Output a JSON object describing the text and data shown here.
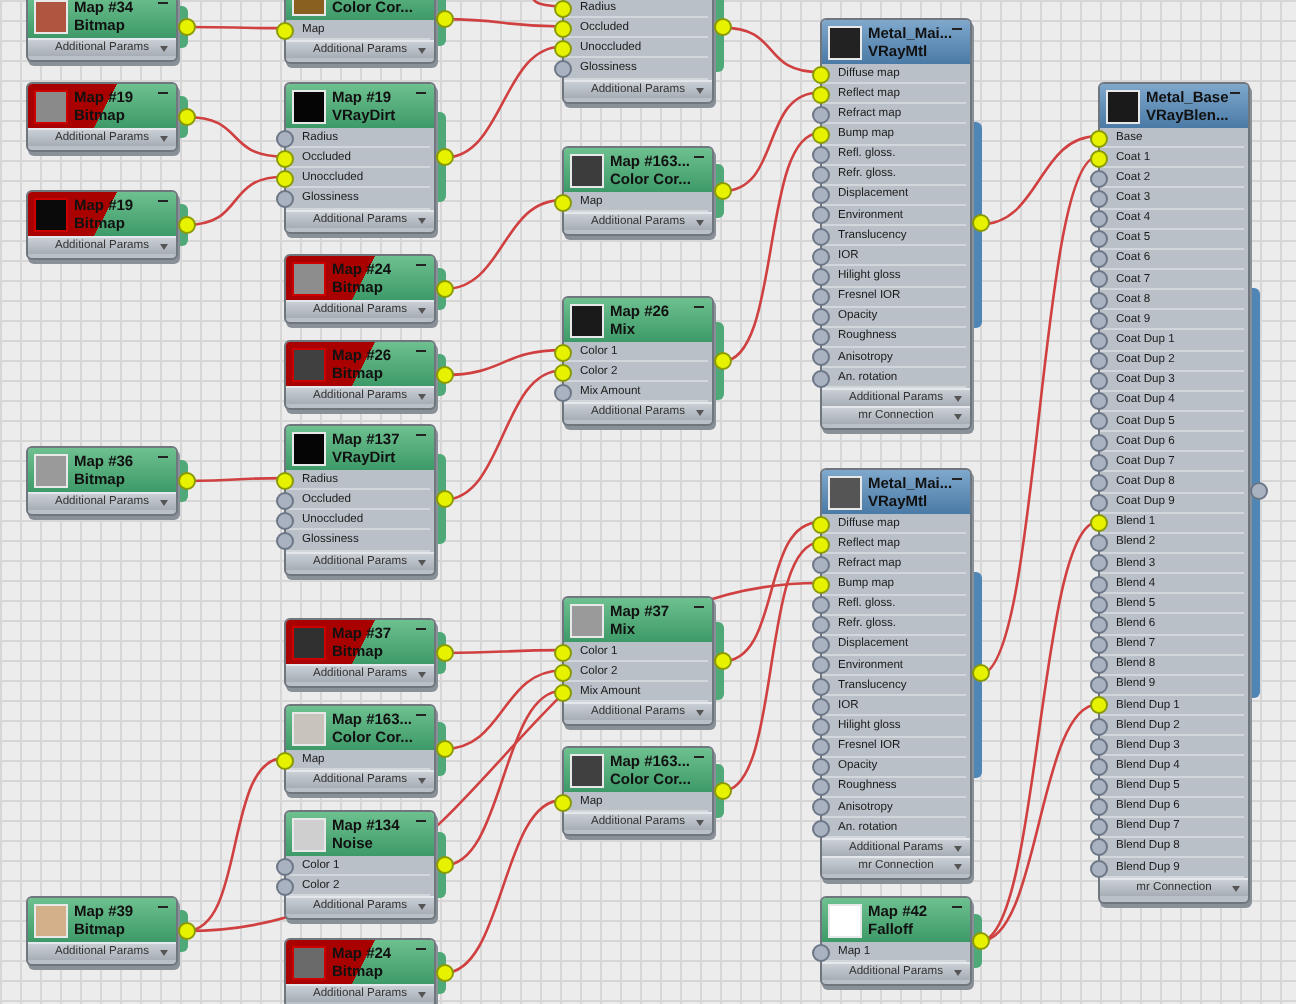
{
  "nodes": [
    {
      "kind": "map",
      "title": "Map #34",
      "subtitle": "Bitmap",
      "missing": false,
      "output_connected": true,
      "footers": [
        "Additional Params"
      ]
    },
    {
      "kind": "map",
      "title": "Map #19",
      "subtitle": "Bitmap",
      "missing": true,
      "output_connected": true,
      "footers": [
        "Additional Params"
      ]
    },
    {
      "kind": "map",
      "title": "Map #19",
      "subtitle": "Bitmap",
      "missing": true,
      "output_connected": true,
      "footers": [
        "Additional Params"
      ]
    },
    {
      "kind": "map",
      "title": "Map #36",
      "subtitle": "Bitmap",
      "missing": false,
      "output_connected": true,
      "footers": [
        "Additional Params"
      ]
    },
    {
      "kind": "map",
      "title": "Map #39",
      "subtitle": "Bitmap",
      "missing": false,
      "output_connected": true,
      "footers": [
        "Additional Params"
      ]
    },
    {
      "kind": "map",
      "subtitle": "Color  Cor...",
      "missing": false,
      "output_connected": true,
      "slots": [
        {
          "label": "Map",
          "connected": true
        }
      ],
      "footers": [
        "Additional Params"
      ]
    },
    {
      "kind": "map",
      "title": "Map #19",
      "subtitle": "VRayDirt",
      "missing": false,
      "output_connected": true,
      "slots": [
        {
          "label": "Radius",
          "connected": false
        },
        {
          "label": "Occluded",
          "connected": true
        },
        {
          "label": "Unoccluded",
          "connected": true
        },
        {
          "label": "Glossiness",
          "connected": false
        }
      ],
      "footers": [
        "Additional Params"
      ]
    },
    {
      "kind": "map",
      "title": "Map #24",
      "subtitle": "Bitmap",
      "missing": true,
      "output_connected": true,
      "footers": [
        "Additional Params"
      ]
    },
    {
      "kind": "map",
      "title": "Map #26",
      "subtitle": "Bitmap",
      "missing": true,
      "output_connected": true,
      "footers": [
        "Additional Params"
      ]
    },
    {
      "kind": "map",
      "title": "Map #137",
      "subtitle": "VRayDirt",
      "missing": false,
      "output_connected": true,
      "slots": [
        {
          "label": "Radius",
          "connected": true
        },
        {
          "label": "Occluded",
          "connected": false
        },
        {
          "label": "Unoccluded",
          "connected": false
        },
        {
          "label": "Glossiness",
          "connected": false
        }
      ],
      "footers": [
        "Additional Params"
      ]
    },
    {
      "kind": "map",
      "title": "Map #37",
      "subtitle": "Bitmap",
      "missing": true,
      "output_connected": true,
      "footers": [
        "Additional Params"
      ]
    },
    {
      "kind": "map",
      "title": "Map #163...",
      "subtitle": "Color  Cor...",
      "missing": false,
      "output_connected": true,
      "slots": [
        {
          "label": "Map",
          "connected": true
        }
      ],
      "footers": [
        "Additional Params"
      ]
    },
    {
      "kind": "map",
      "title": "Map #134",
      "subtitle": "Noise",
      "missing": false,
      "output_connected": true,
      "slots": [
        {
          "label": "Color 1",
          "connected": false
        },
        {
          "label": "Color 2",
          "connected": false
        }
      ],
      "footers": [
        "Additional Params"
      ]
    },
    {
      "kind": "map",
      "title": "Map #24",
      "subtitle": "Bitmap",
      "missing": true,
      "output_connected": true,
      "footers": [
        "Additional Params"
      ]
    },
    {
      "kind": "map",
      "output_connected": true,
      "slots": [
        {
          "label": "Radius",
          "connected": true
        },
        {
          "label": "Occluded",
          "connected": true
        },
        {
          "label": "Unoccluded",
          "connected": true
        },
        {
          "label": "Glossiness",
          "connected": false
        }
      ],
      "footers": [
        "Additional Params"
      ]
    },
    {
      "kind": "map",
      "title": "Map #163...",
      "subtitle": "Color  Cor...",
      "missing": false,
      "output_connected": true,
      "slots": [
        {
          "label": "Map",
          "connected": true
        }
      ],
      "footers": [
        "Additional Params"
      ]
    },
    {
      "kind": "map",
      "title": "Map #26",
      "subtitle": "Mix",
      "missing": false,
      "output_connected": true,
      "slots": [
        {
          "label": "Color 1",
          "connected": true
        },
        {
          "label": "Color 2",
          "connected": true
        },
        {
          "label": "Mix Amount",
          "connected": false
        }
      ],
      "footers": [
        "Additional Params"
      ]
    },
    {
      "kind": "map",
      "title": "Map #37",
      "subtitle": "Mix",
      "missing": false,
      "output_connected": true,
      "slots": [
        {
          "label": "Color 1",
          "connected": true
        },
        {
          "label": "Color 2",
          "connected": true
        },
        {
          "label": "Mix Amount",
          "connected": true
        }
      ],
      "footers": [
        "Additional Params"
      ]
    },
    {
      "kind": "map",
      "title": "Map #163...",
      "subtitle": "Color  Cor...",
      "missing": false,
      "output_connected": true,
      "slots": [
        {
          "label": "Map",
          "connected": true
        }
      ],
      "footers": [
        "Additional Params"
      ]
    },
    {
      "kind": "material",
      "title": "Metal_Mai...",
      "subtitle": "VRayMtl",
      "missing": false,
      "output_connected": true,
      "slots": [
        {
          "label": "Diffuse map",
          "connected": true
        },
        {
          "label": "Reflect map",
          "connected": true
        },
        {
          "label": "Refract map",
          "connected": false
        },
        {
          "label": "Bump map",
          "connected": true
        },
        {
          "label": "Refl. gloss.",
          "connected": false
        },
        {
          "label": "Refr. gloss.",
          "connected": false
        },
        {
          "label": "Displacement",
          "connected": false
        },
        {
          "label": "Environment",
          "connected": false
        },
        {
          "label": "Translucency",
          "connected": false
        },
        {
          "label": "IOR",
          "connected": false
        },
        {
          "label": "Hilight gloss",
          "connected": false
        },
        {
          "label": "Fresnel IOR",
          "connected": false
        },
        {
          "label": "Opacity",
          "connected": false
        },
        {
          "label": "Roughness",
          "connected": false
        },
        {
          "label": "Anisotropy",
          "connected": false
        },
        {
          "label": "An. rotation",
          "connected": false
        }
      ],
      "footers": [
        "Additional Params",
        "mr Connection"
      ]
    },
    {
      "kind": "material",
      "title": "Metal_Mai...",
      "subtitle": "VRayMtl",
      "missing": false,
      "output_connected": true,
      "slots": [
        {
          "label": "Diffuse map",
          "connected": true
        },
        {
          "label": "Reflect map",
          "connected": true
        },
        {
          "label": "Refract map",
          "connected": false
        },
        {
          "label": "Bump map",
          "connected": true
        },
        {
          "label": "Refl. gloss.",
          "connected": false
        },
        {
          "label": "Refr. gloss.",
          "connected": false
        },
        {
          "label": "Displacement",
          "connected": false
        },
        {
          "label": "Environment",
          "connected": false
        },
        {
          "label": "Translucency",
          "connected": false
        },
        {
          "label": "IOR",
          "connected": false
        },
        {
          "label": "Hilight gloss",
          "connected": false
        },
        {
          "label": "Fresnel IOR",
          "connected": false
        },
        {
          "label": "Opacity",
          "connected": false
        },
        {
          "label": "Roughness",
          "connected": false
        },
        {
          "label": "Anisotropy",
          "connected": false
        },
        {
          "label": "An. rotation",
          "connected": false
        }
      ],
      "footers": [
        "Additional Params",
        "mr Connection"
      ]
    },
    {
      "kind": "map",
      "title": "Map #42",
      "subtitle": "Falloff",
      "missing": false,
      "output_connected": true,
      "slots": [
        {
          "label": "Map 1",
          "connected": false
        }
      ],
      "footers": [
        "Additional Params"
      ]
    },
    {
      "kind": "material",
      "title": "Metal_Base",
      "subtitle": "VRayBlen...",
      "missing": false,
      "output_connected": false,
      "slots": [
        {
          "label": "Base",
          "connected": true
        },
        {
          "label": "Coat 1",
          "connected": true
        },
        {
          "label": "Coat 2",
          "connected": false
        },
        {
          "label": "Coat 3",
          "connected": false
        },
        {
          "label": "Coat 4",
          "connected": false
        },
        {
          "label": "Coat 5",
          "connected": false
        },
        {
          "label": "Coat 6",
          "connected": false
        },
        {
          "label": "Coat 7",
          "connected": false
        },
        {
          "label": "Coat 8",
          "connected": false
        },
        {
          "label": "Coat 9",
          "connected": false
        },
        {
          "label": "Coat Dup 1",
          "connected": false
        },
        {
          "label": "Coat Dup 2",
          "connected": false
        },
        {
          "label": "Coat Dup 3",
          "connected": false
        },
        {
          "label": "Coat Dup 4",
          "connected": false
        },
        {
          "label": "Coat Dup 5",
          "connected": false
        },
        {
          "label": "Coat Dup 6",
          "connected": false
        },
        {
          "label": "Coat Dup 7",
          "connected": false
        },
        {
          "label": "Coat Dup 8",
          "connected": false
        },
        {
          "label": "Coat Dup 9",
          "connected": false
        },
        {
          "label": "Blend 1",
          "connected": true
        },
        {
          "label": "Blend 2",
          "connected": false
        },
        {
          "label": "Blend 3",
          "connected": false
        },
        {
          "label": "Blend 4",
          "connected": false
        },
        {
          "label": "Blend 5",
          "connected": false
        },
        {
          "label": "Blend 6",
          "connected": false
        },
        {
          "label": "Blend 7",
          "connected": false
        },
        {
          "label": "Blend 8",
          "connected": false
        },
        {
          "label": "Blend 9",
          "connected": false
        },
        {
          "label": "Blend Dup 1",
          "connected": true
        },
        {
          "label": "Blend Dup 2",
          "connected": false
        },
        {
          "label": "Blend Dup 3",
          "connected": false
        },
        {
          "label": "Blend Dup 4",
          "connected": false
        },
        {
          "label": "Blend Dup 5",
          "connected": false
        },
        {
          "label": "Blend Dup 6",
          "connected": false
        },
        {
          "label": "Blend Dup 7",
          "connected": false
        },
        {
          "label": "Blend Dup 8",
          "connected": false
        },
        {
          "label": "Blend Dup 9",
          "connected": false
        }
      ],
      "footers": [
        "mr Connection"
      ]
    }
  ]
}
